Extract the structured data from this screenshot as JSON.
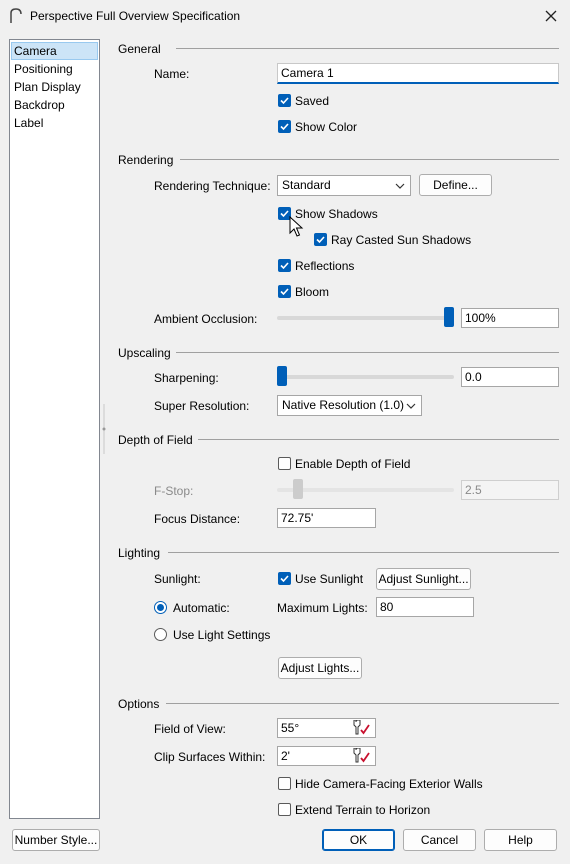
{
  "window": {
    "title": "Perspective Full Overview Specification"
  },
  "sidebar": {
    "items": [
      {
        "label": "Camera",
        "selected": true
      },
      {
        "label": "Positioning"
      },
      {
        "label": "Plan Display"
      },
      {
        "label": "Backdrop"
      },
      {
        "label": "Label"
      }
    ]
  },
  "general": {
    "heading": "General",
    "name_label": "Name:",
    "name_value": "Camera 1",
    "saved_label": "Saved",
    "show_color_label": "Show Color"
  },
  "rendering": {
    "heading": "Rendering",
    "technique_label": "Rendering Technique:",
    "technique_value": "Standard",
    "define_button": "Define...",
    "show_shadows_label": "Show Shadows",
    "ray_casted_label": "Ray Casted Sun Shadows",
    "reflections_label": "Reflections",
    "bloom_label": "Bloom",
    "ambient_label": "Ambient Occlusion:",
    "ambient_value": "100%",
    "ambient_level": 1.0
  },
  "upscaling": {
    "heading": "Upscaling",
    "sharpening_label": "Sharpening:",
    "sharpening_value": "0.0",
    "sharpening_level": 0.0,
    "super_res_label": "Super Resolution:",
    "super_res_value": "Native Resolution (1.0)"
  },
  "depth_of_field": {
    "heading": "Depth of Field",
    "enable_label": "Enable Depth of Field",
    "fstop_label": "F-Stop:",
    "fstop_value": "2.5",
    "focus_label": "Focus Distance:",
    "focus_value": "72.75'"
  },
  "lighting": {
    "heading": "Lighting",
    "sunlight_label": "Sunlight:",
    "use_sunlight_label": "Use Sunlight",
    "adjust_sunlight_button": "Adjust Sunlight...",
    "automatic_label": "Automatic:",
    "max_lights_label": "Maximum Lights:",
    "max_lights_value": "80",
    "use_light_settings_label": "Use Light Settings",
    "adjust_lights_button": "Adjust Lights..."
  },
  "options": {
    "heading": "Options",
    "fov_label": "Field of View:",
    "fov_value": "55°",
    "clip_label": "Clip Surfaces Within:",
    "clip_value": "2'",
    "hide_walls_label": "Hide Camera-Facing Exterior Walls",
    "extend_terrain_label": "Extend Terrain to Horizon"
  },
  "footer": {
    "number_style_button": "Number Style...",
    "ok_button": "OK",
    "cancel_button": "Cancel",
    "help_button": "Help"
  },
  "colors": {
    "accent": "#005fb8",
    "selection": "#cce4f7"
  },
  "icons": [
    "app-icon",
    "close-icon",
    "chevron-down-icon",
    "checkmark-icon",
    "mouse-cursor-icon",
    "edit-icon"
  ]
}
